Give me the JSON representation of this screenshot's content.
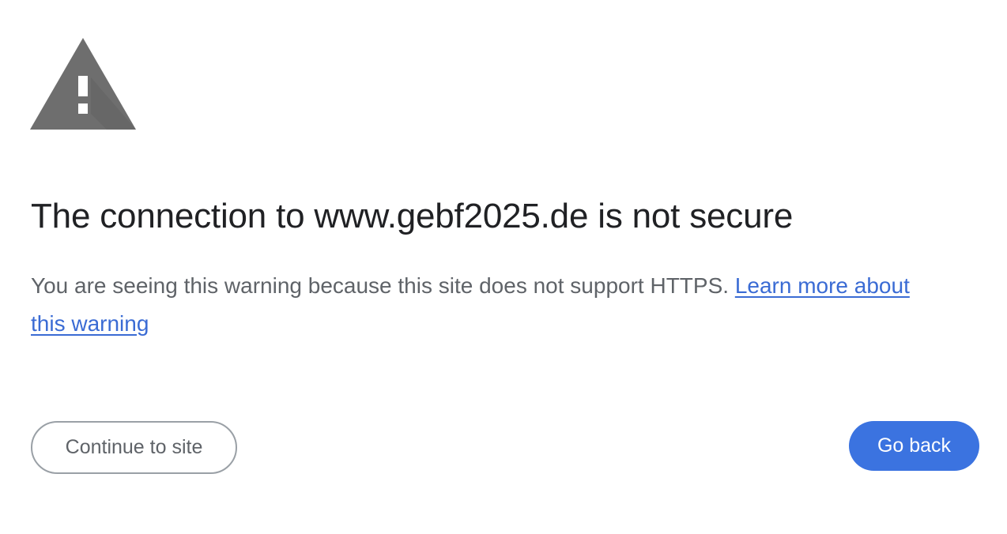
{
  "warning": {
    "icon": "warning-triangle-icon",
    "icon_color": "#6e6e6e",
    "title": "The connection to www.gebf2025.de is not secure",
    "explanation": "You are seeing this warning because this site does not support HTTPS.",
    "learn_more_link": "Learn more about this warning"
  },
  "actions": {
    "continue_label": "Continue to site",
    "back_label": "Go back"
  },
  "colors": {
    "title": "#202124",
    "body_text": "#5f6368",
    "link": "#3a6bd4",
    "primary_button": "#3b73e0",
    "secondary_button_border": "#9aa0a6"
  }
}
